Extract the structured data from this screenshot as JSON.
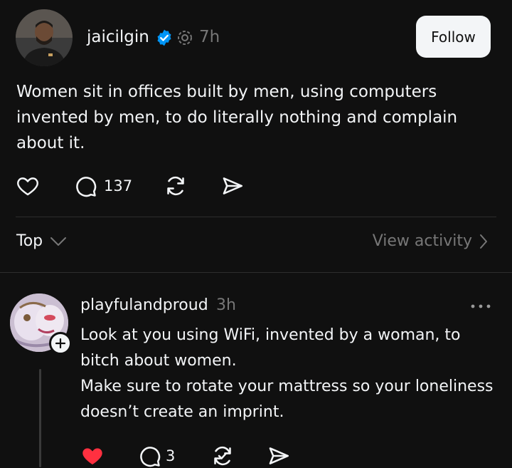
{
  "post": {
    "username": "jaicilgin",
    "timestamp": "7h",
    "follow_label": "Follow",
    "text": "Women sit in offices built by men, using computers\ninvented by men, to do literally nothing and complain\nabout it.",
    "reply_count": "137",
    "verified_color": "#0095f6"
  },
  "replies_header": {
    "sort_label": "Top",
    "view_activity_label": "View activity"
  },
  "reply": {
    "username": "playfulandproud",
    "timestamp": "3h",
    "lines": [
      "Look at you using WiFi, invented by a woman, to",
      "bitch about women.",
      "Make sure to rotate your mattress so your loneliness",
      "doesn’t create an imprint."
    ],
    "reply_count": "3",
    "liked": true,
    "like_color": "#ff3040"
  }
}
